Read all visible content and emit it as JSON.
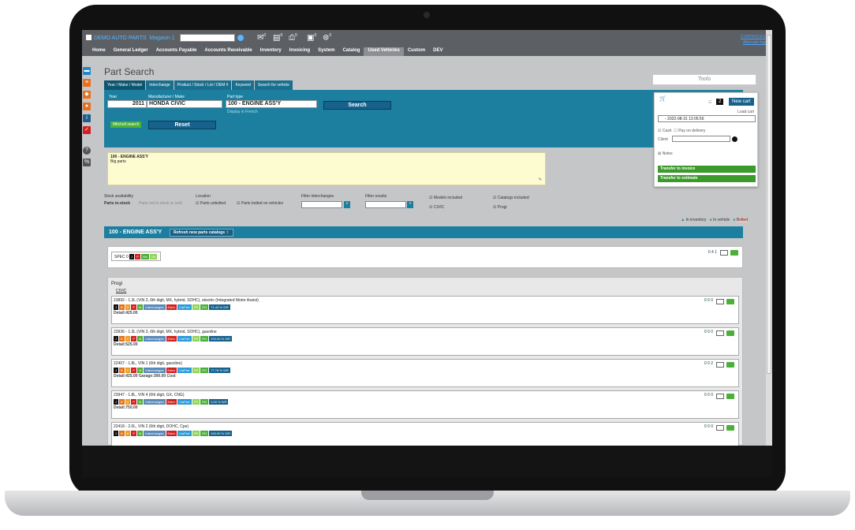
{
  "app": {
    "brand": "DEMO AUTO PARTS",
    "store": "Magasin 1",
    "user": "CONTROLEUR",
    "alternate": "Alternate login",
    "toolbar_counts": [
      "0",
      "0",
      "0",
      "0",
      "0"
    ]
  },
  "menu": [
    "Home",
    "General Ledger",
    "Accounts Payable",
    "Accounts Receivable",
    "Inventory",
    "Invoicing",
    "System",
    "Catalog",
    "Used Vehicles",
    "Custom",
    "DEV"
  ],
  "menu_active": "Used Vehicles",
  "page": {
    "title": "Part Search",
    "tabs": [
      "Year / Make / Model",
      "Interchange",
      "Product / Stock / Lot / OEM #",
      "Keyword",
      "Search for vehicle"
    ]
  },
  "search": {
    "year_label": "Year",
    "year": "2011",
    "make_label": "Manufacturer / Make",
    "make": "HONDA CIVIC",
    "part_type_label": "Part type",
    "part_type": "100 - ENGINE ASS'Y",
    "display_french": "Display in French",
    "search_button": "Search",
    "mitchell": "Mitchell search",
    "reset_button": "Reset"
  },
  "note": {
    "line1": "100 - ENGINE ASS'Y",
    "line2": "Big parts"
  },
  "filters": {
    "stock_availability": "Stock availability",
    "in_stock": "Parts in-stock",
    "not_in_stock": "Parts not in stock or sold",
    "location": "Location",
    "unbolted": "Parts unbolted",
    "bolted": "Parts bolted on vehicles",
    "filter_interchanges": "Filter interchanges",
    "filter_results": "Filter results",
    "models_included": "Models included",
    "model": "CIVIC",
    "catalogs_included": "Catalogs included",
    "catalog": "Progi"
  },
  "legend": {
    "in_inventory": "In inventory",
    "in_vehicle": "In vehicle",
    "bolted": "Bolted"
  },
  "section": {
    "title": "100 - ENGINE ASS'Y",
    "refresh": "Refresh new parts catalogs"
  },
  "spec": {
    "label": "SPEC 0",
    "counts": "0  4  1"
  },
  "catalog": {
    "name": "Progi",
    "model": "CIVIC"
  },
  "rows": [
    {
      "desc": "23892 - 1.3L (VIN 3, 6th digit, MX, hybrid, SOHC), electric (Integrated Motor Assist)",
      "pct": "71.43 % S/R",
      "detail": "Detail:425.00",
      "counts": "0  0  0"
    },
    {
      "desc": "23936 - 1.3L (VIN 3, 6th digit, MX, hybrid, SOHC), gasoline",
      "pct": "100.00 % S/R",
      "detail": "Detail:525.00",
      "counts": "0  0  0"
    },
    {
      "desc": "22407 - 1.8L, VIN 1 (6th digit, gasoline)",
      "pct": "77.78 % S/R",
      "detail": "Detail:425.00  Garage:300.00  Cost",
      "counts": "0  0  2"
    },
    {
      "desc": "23947 - 1.8L, VIN 4 (6th digit, GX, CNG)",
      "pct": "0.00 % S/R",
      "detail": "Detail:750.00",
      "counts": "0  0  0"
    },
    {
      "desc": "22418 - 2.0L, VIN 2 (6th digit, DOHC, Cpe)",
      "pct": "100.00 % S/R",
      "detail": "",
      "counts": "0  0  0"
    }
  ],
  "row_chips": [
    "J",
    "B",
    "V",
    "P",
    "M",
    "Interchanges",
    "Eden",
    "CarPart",
    "PR",
    "RG"
  ],
  "tools": {
    "label": "Tools",
    "cart_count": "2",
    "new_cart": "New cart",
    "load_cart": "Load cart",
    "cart_date": "- 2022-08-31 13:05:56",
    "cash": "Cash",
    "pay_on_delivery": "Pay on delivery",
    "client": "Client",
    "notes": "Notes",
    "transfer_invoice": "Transfer to invoice",
    "transfer_estimate": "Transfer to estimate"
  }
}
